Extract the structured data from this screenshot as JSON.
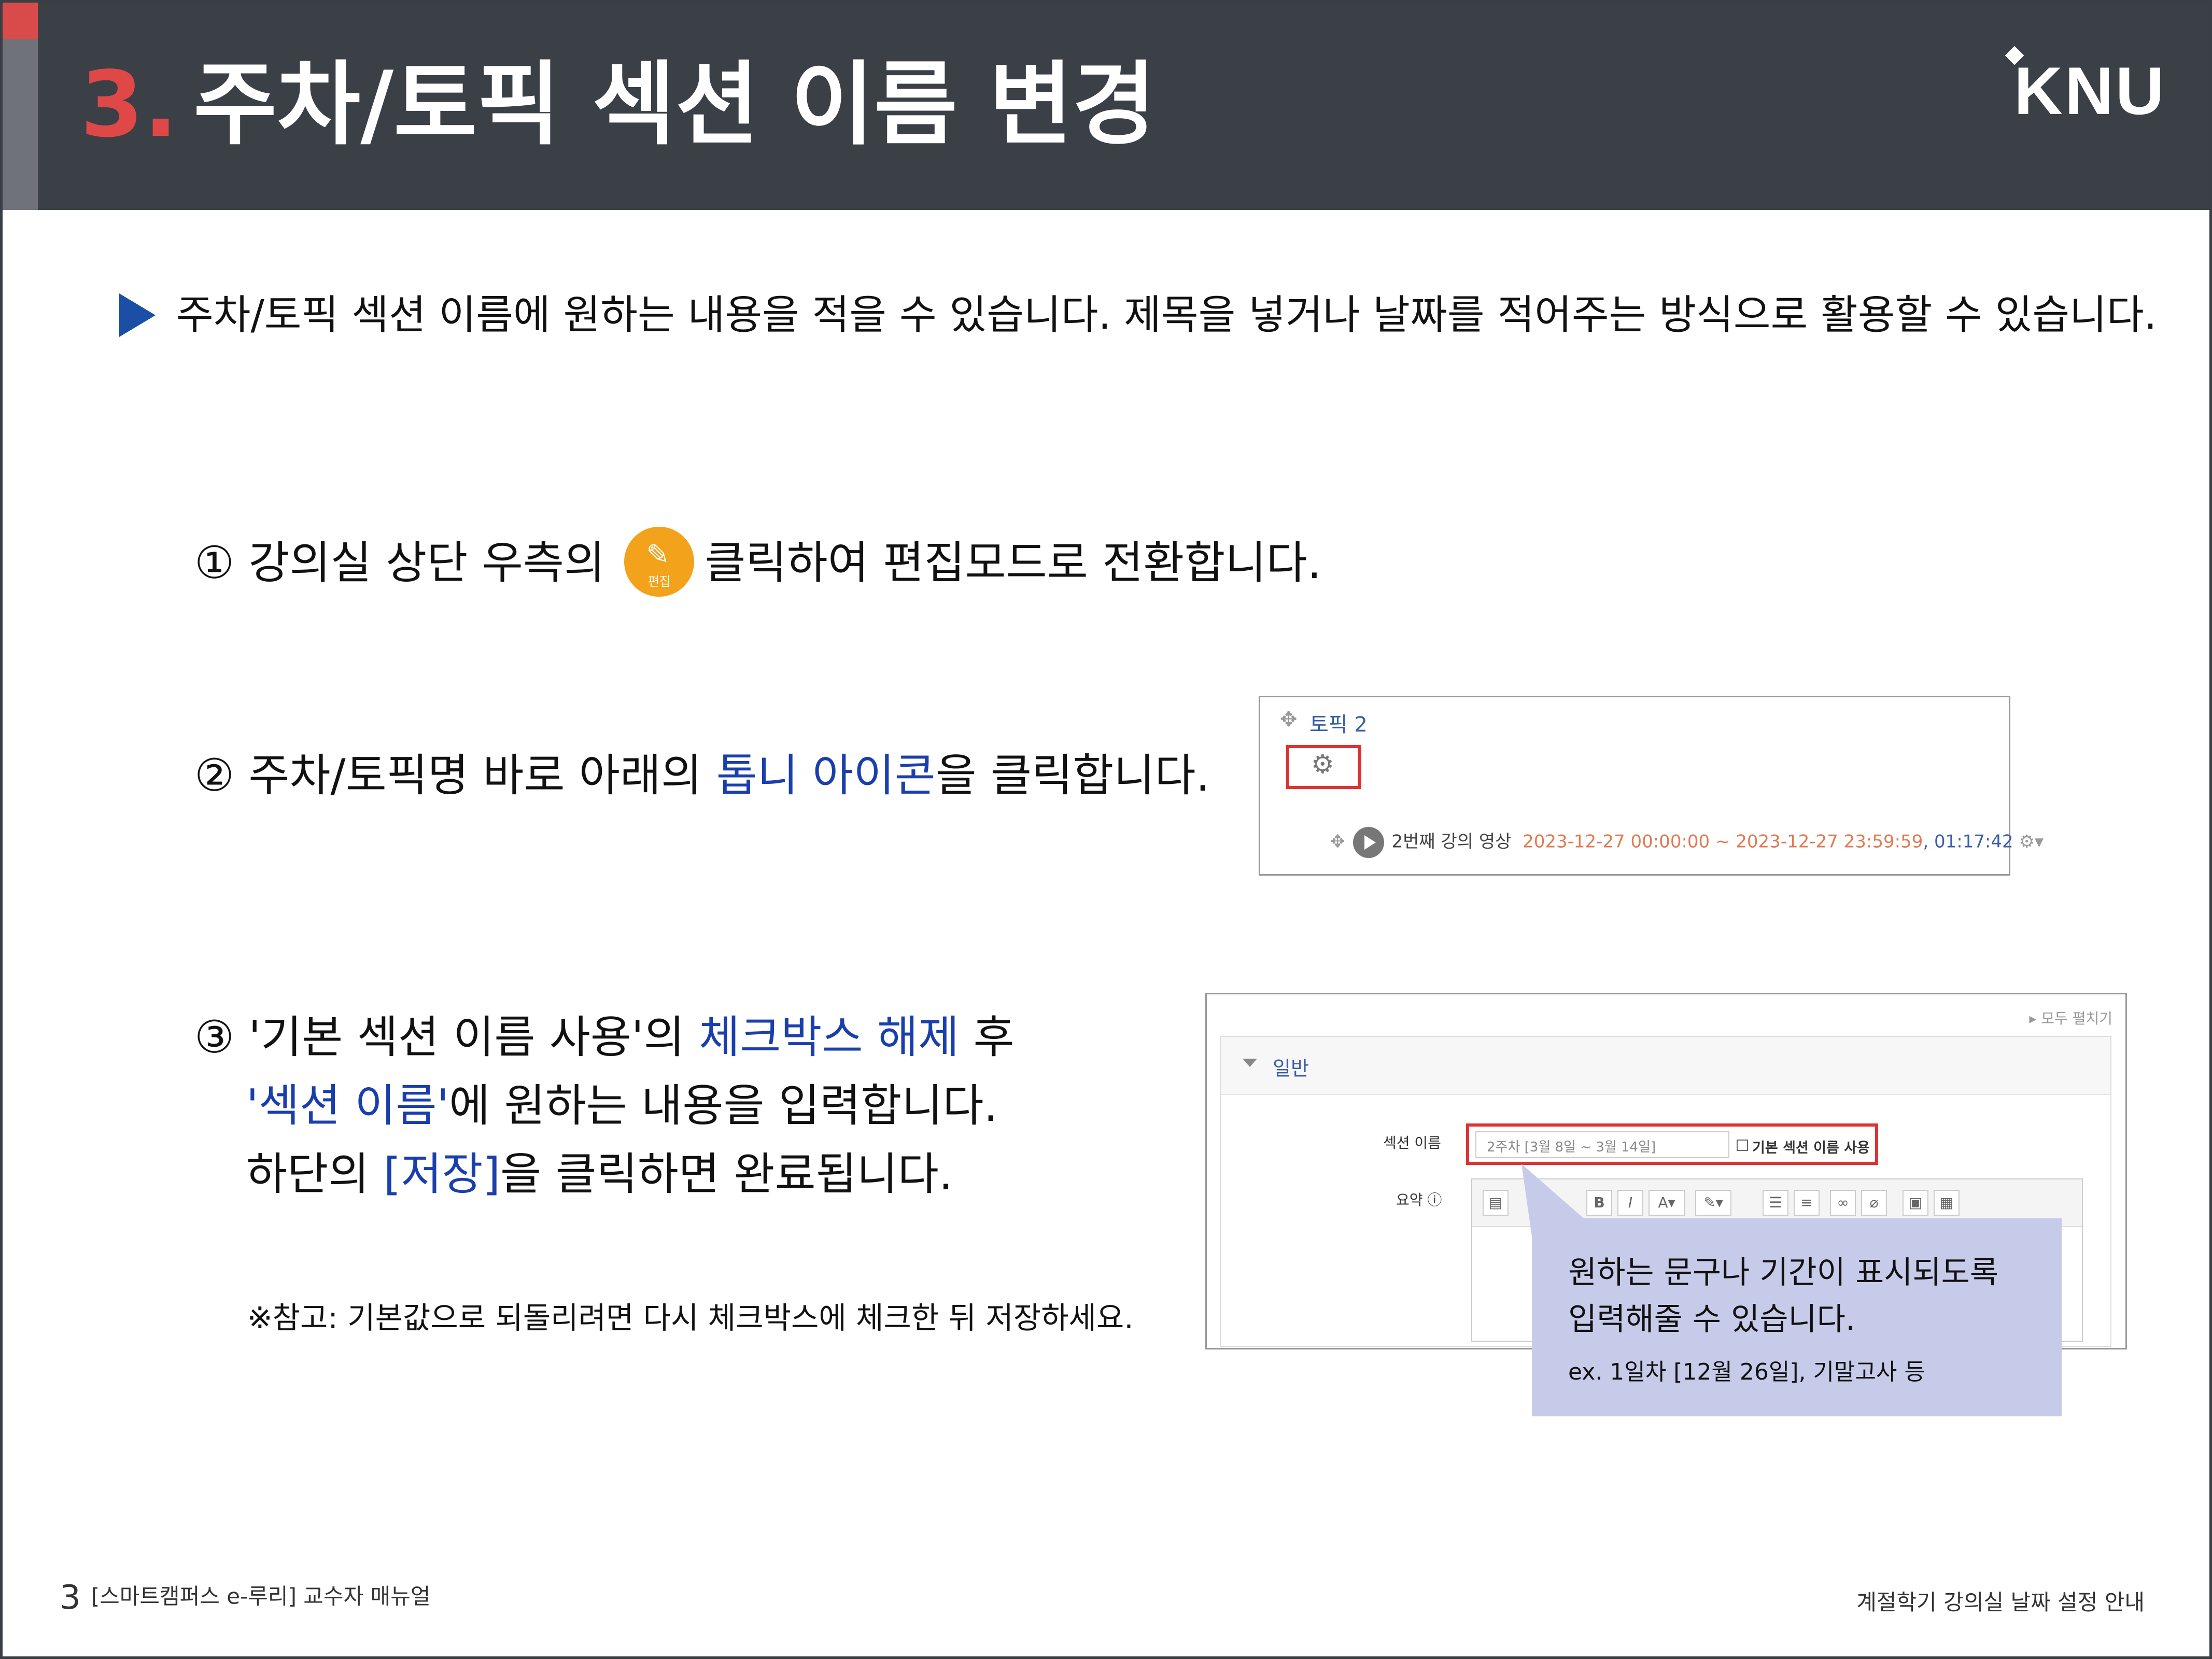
{
  "header": {
    "number": "3.",
    "title": "주차/토픽 섹션 이름 변경",
    "logo": "KNU"
  },
  "intro": "주차/토픽 섹션 이름에 원하는 내용을 적을 수 있습니다. 제목을 넣거나 날짜를 적어주는 방식으로 활용할 수 있습니다.",
  "step1": {
    "before": "① 강의실 상단 우측의 ",
    "icon_label": "편집",
    "after": "클릭하여 편집모드로 전환합니다."
  },
  "step2": {
    "before": "② 주차/토픽명 바로 아래의 ",
    "highlight": "톱니 아이콘",
    "after": "을 클릭합니다."
  },
  "step3": {
    "line1_before": "③ '기본 섹션 이름 사용'의 ",
    "line1_highlight": "체크박스 해제",
    "line1_after": " 후",
    "line2_highlight": "'섹션 이름'",
    "line2_after": "에 원하는 내용을 입력합니다.",
    "line3_before": "하단의 ",
    "line3_highlight": "[저장]",
    "line3_after": "을 클릭하면 완료됩니다."
  },
  "note": "※참고: 기본값으로 되돌리려면 다시 체크박스에 체크한 뒤 저장하세요.",
  "shot1": {
    "topic": "토픽 2",
    "item": "2번째 강의 영상",
    "dates": "2023-12-27 00:00:00 ~ 2023-12-27 23:59:59",
    "duration": ", 01:17:42"
  },
  "shot2": {
    "expand_all": "▸ 모두 펼치기",
    "section": "일반",
    "name_label": "섹션 이름",
    "name_value": "2주차 [3월 8일 ~ 3월 14일]",
    "checkbox_label": "기본 섹션 이름 사용",
    "summary_label": "요약 ⓘ"
  },
  "callout": {
    "line1": "원하는 문구나 기간이 표시되도록",
    "line2": "입력해줄 수 있습니다.",
    "example": "ex. 1일차 [12월 26일], 기말고사 등"
  },
  "footer": {
    "page": "3",
    "left": "[스마트캠퍼스 e-루리]  교수자 매뉴얼",
    "right": "계절학기 강의실 날짜 설정 안내"
  },
  "colors": {
    "header_bg": "#3b4047",
    "accent_red": "#e04848",
    "highlight_blue": "#1a3fad",
    "callout_bg": "#c7cbea",
    "edit_orange": "#f3a21b"
  }
}
